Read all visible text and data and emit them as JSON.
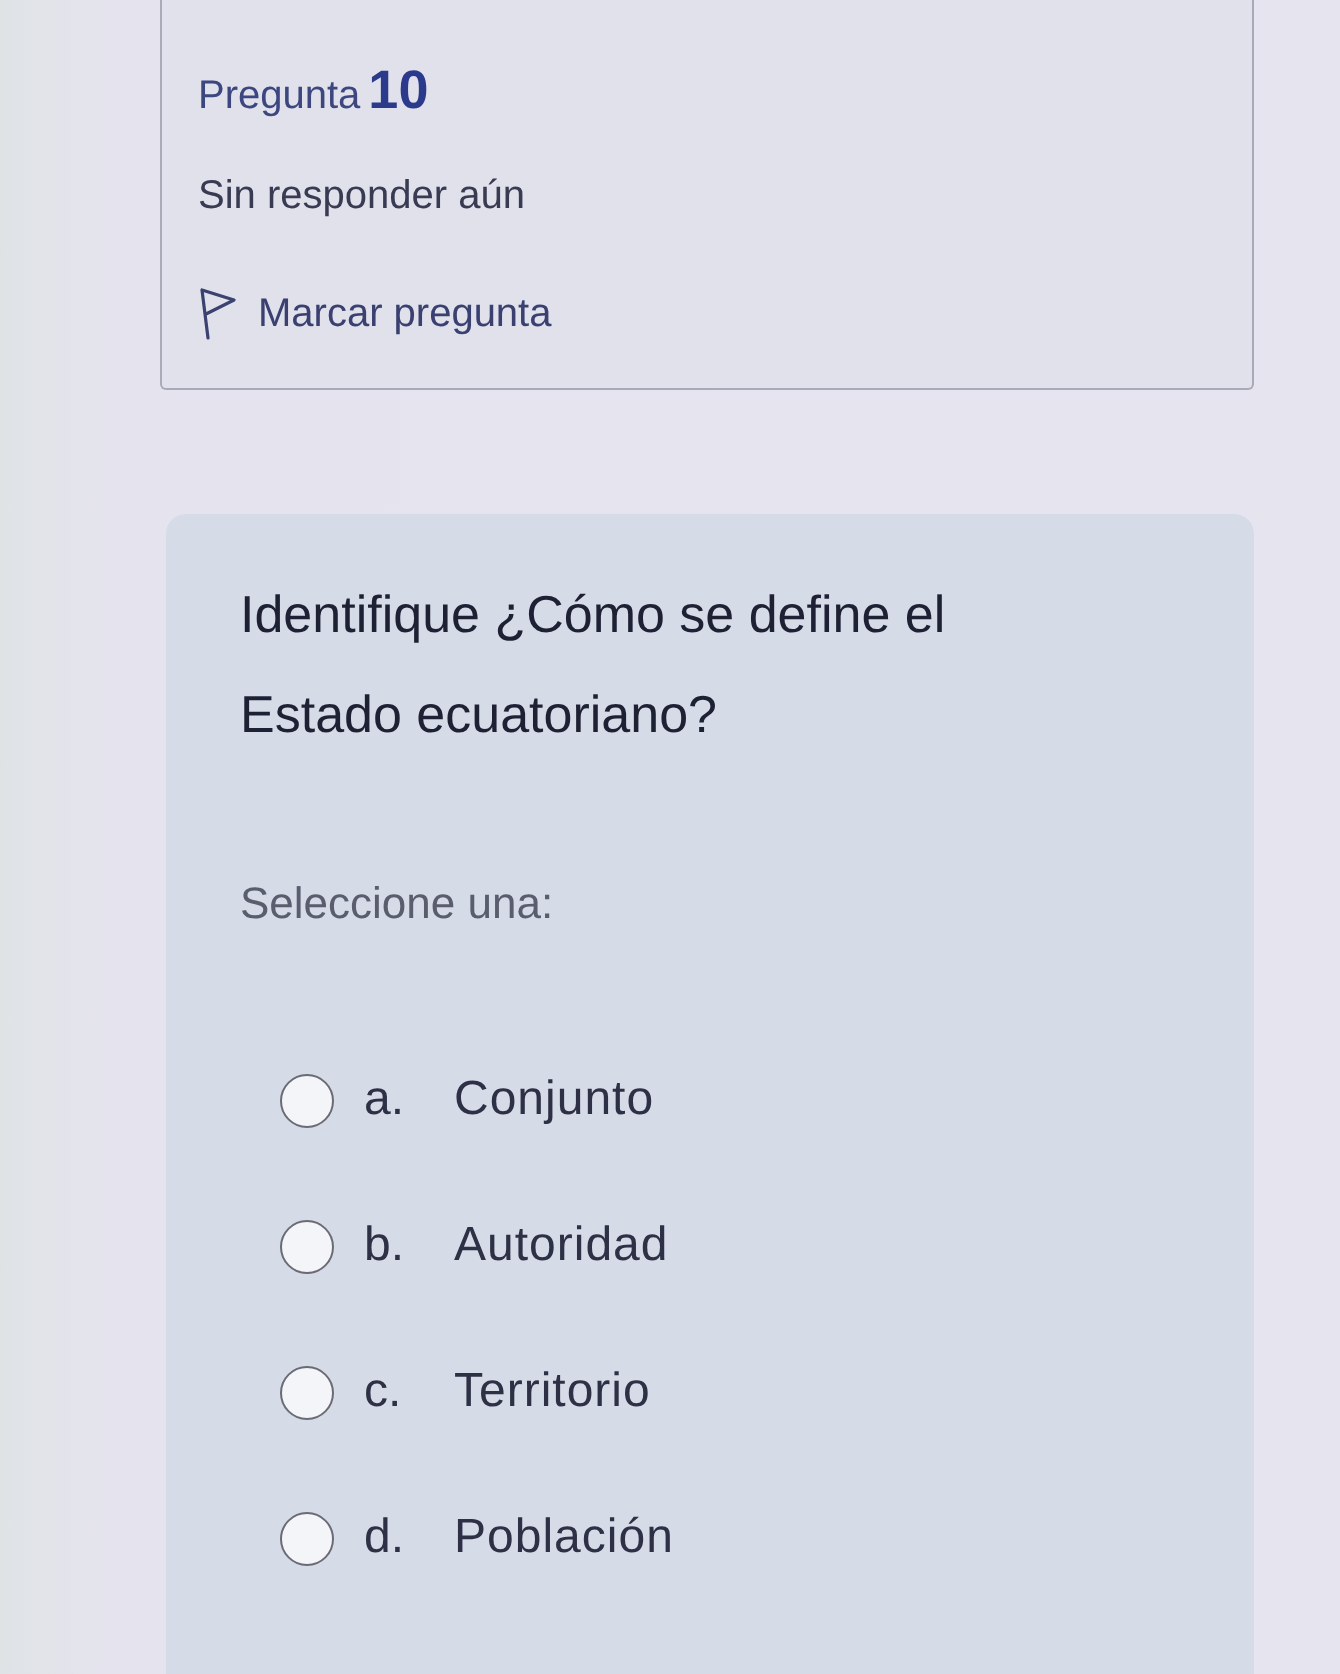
{
  "question_info": {
    "label": "Pregunta",
    "number": "10",
    "status": "Sin responder aún",
    "flag": {
      "label": "Marcar pregunta",
      "flagged": false
    }
  },
  "question": {
    "text": "Identifique ¿Cómo se define el Estado ecuatoriano?",
    "prompt": "Seleccione una:",
    "options": [
      {
        "letter": "a.",
        "label": "Conjunto",
        "selected": false
      },
      {
        "letter": "b.",
        "label": "Autoridad",
        "selected": false
      },
      {
        "letter": "c.",
        "label": "Territorio",
        "selected": false
      },
      {
        "letter": "d.",
        "label": "Población",
        "selected": false
      }
    ]
  }
}
